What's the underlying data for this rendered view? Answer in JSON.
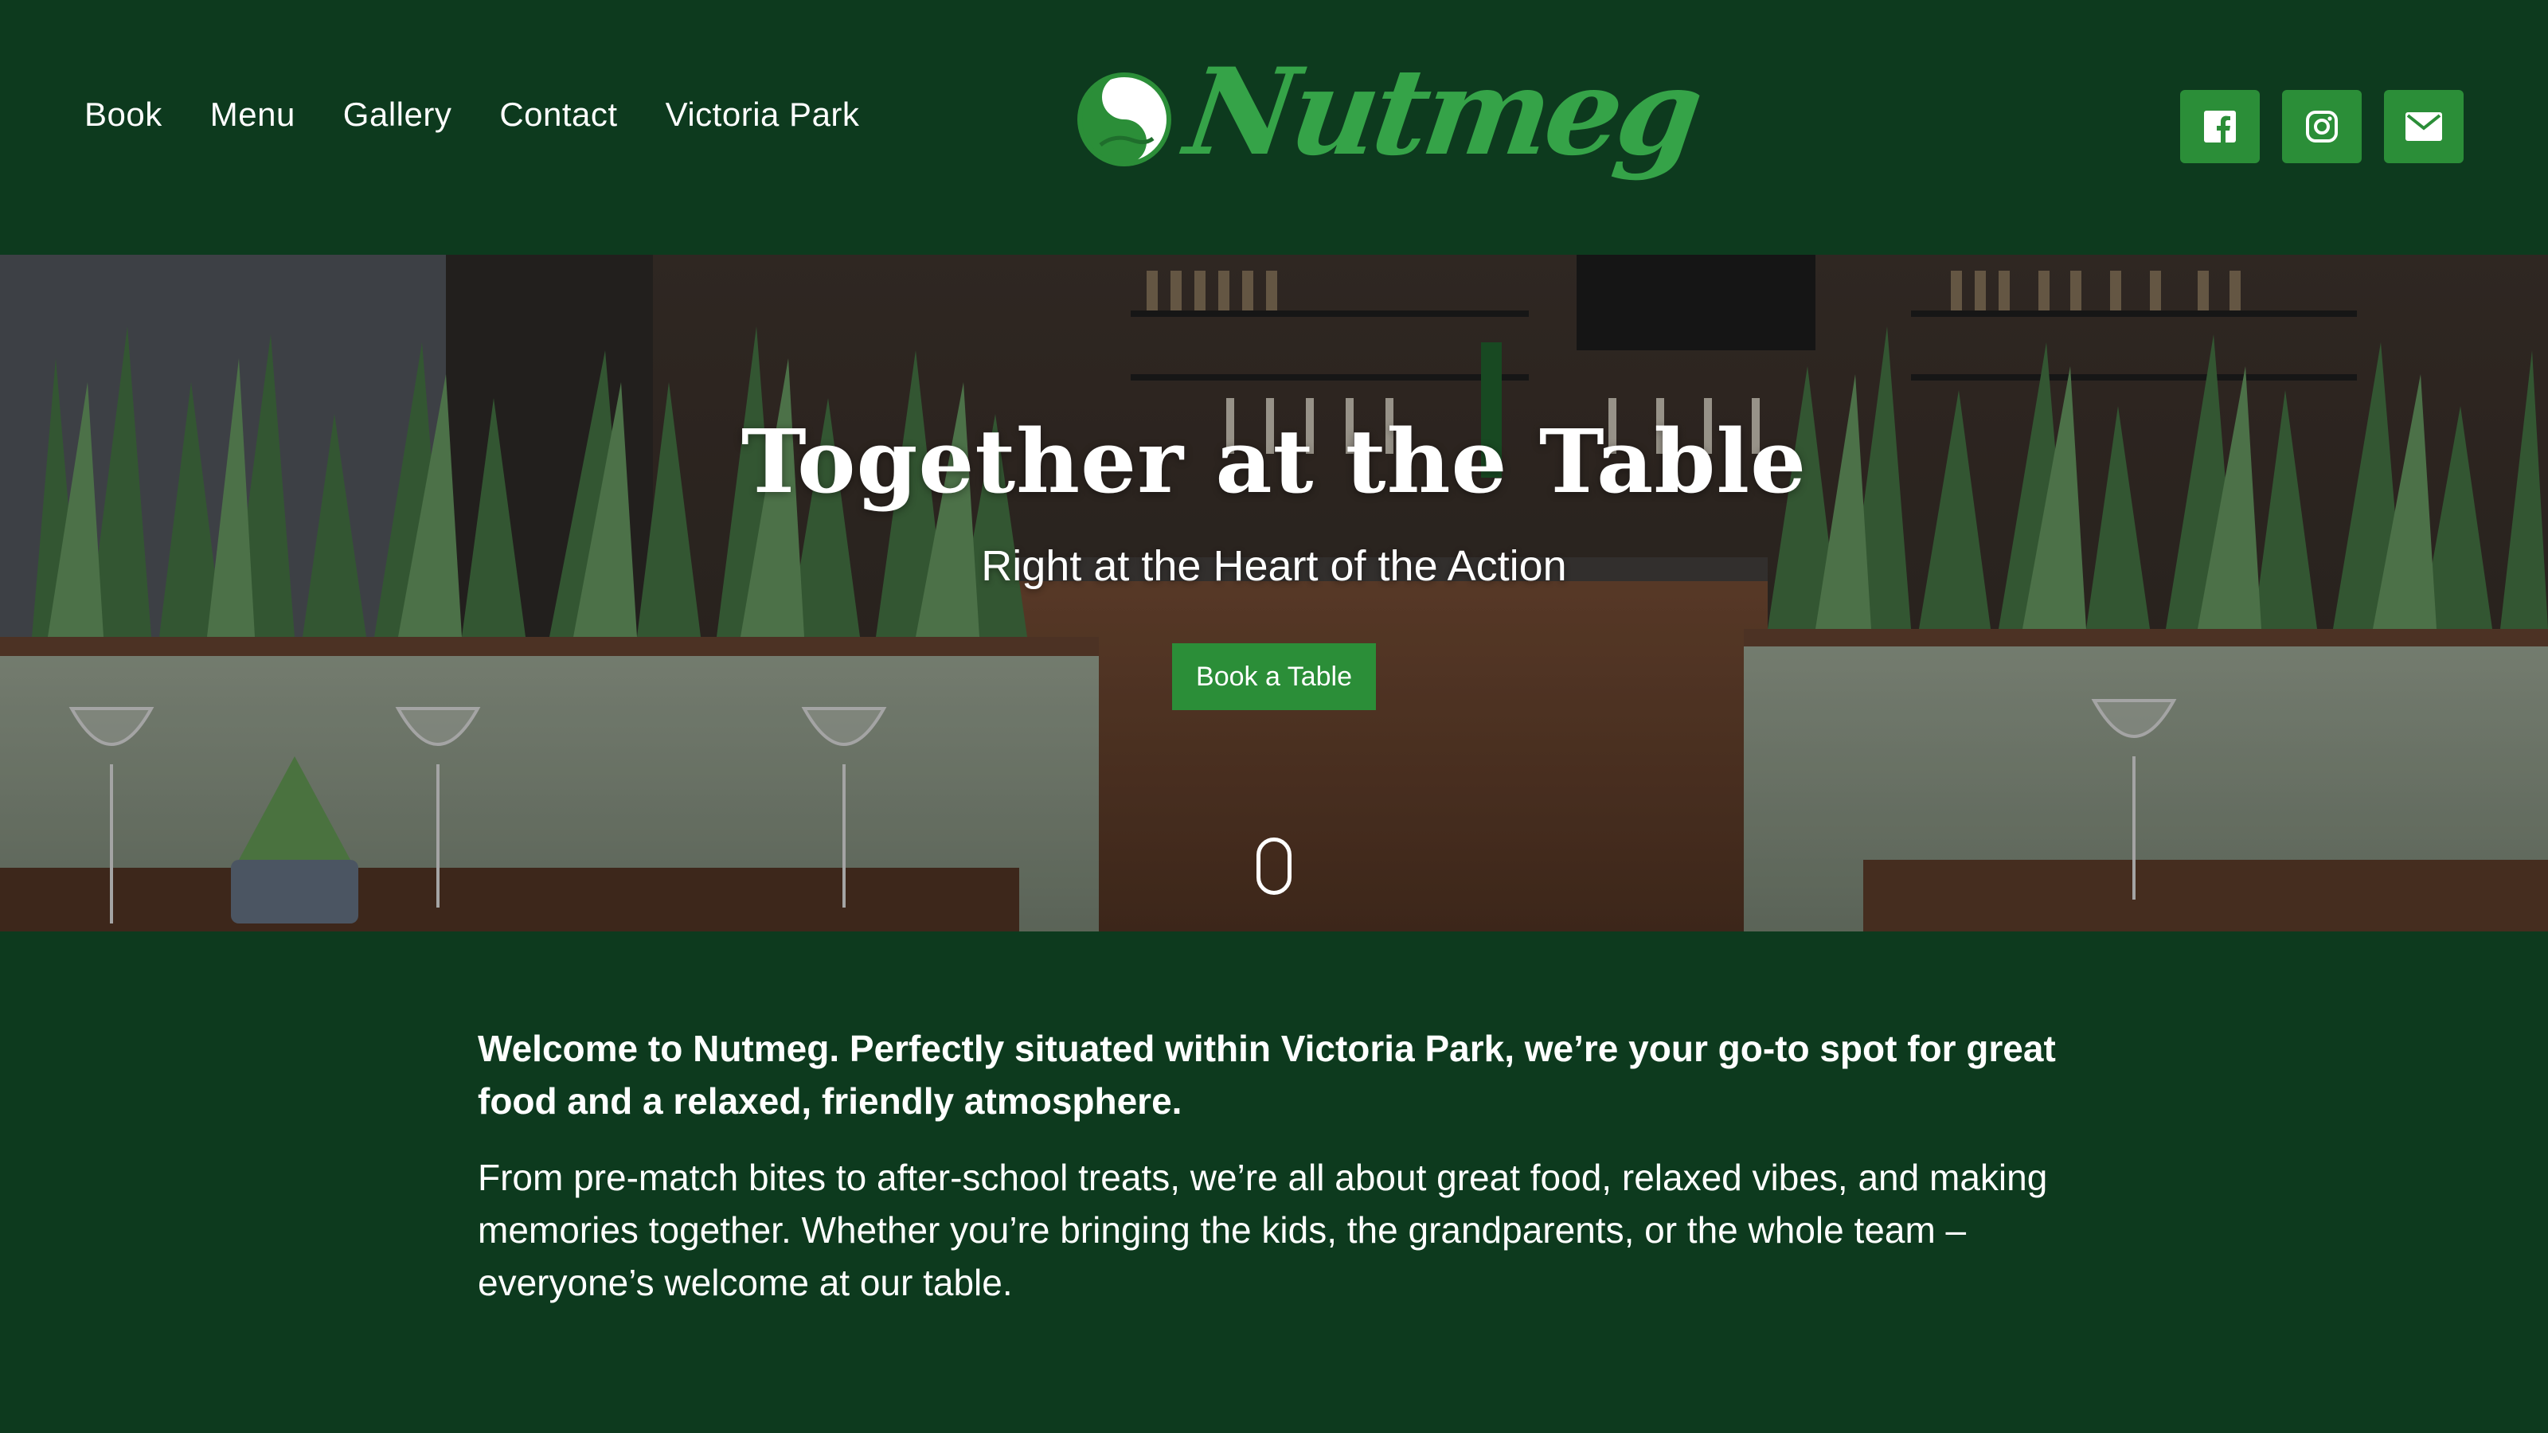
{
  "header": {
    "nav": [
      {
        "label": "Book"
      },
      {
        "label": "Menu"
      },
      {
        "label": "Gallery"
      },
      {
        "label": "Contact"
      },
      {
        "label": "Victoria Park"
      }
    ],
    "logo_text": "Nutmeg",
    "socials": [
      {
        "icon": "facebook-icon"
      },
      {
        "icon": "instagram-icon"
      },
      {
        "icon": "email-icon"
      }
    ]
  },
  "hero": {
    "title": "Together at the Table",
    "subtitle": "Right at the Heart of the Action",
    "cta_label": "Book a Table"
  },
  "intro": {
    "lead": "Welcome to Nutmeg. Perfectly situated within Victoria Park, we’re your go-to spot for great food and a relaxed, friendly atmosphere.",
    "body": "From pre-match bites to after-school treats, we’re all about great food, relaxed vibes, and making memories together. Whether you’re bringing the kids, the grandparents, or the whole team – everyone’s welcome at our table."
  },
  "colors": {
    "background": "#0d3a1e",
    "accent": "#2b8e38",
    "logo_green": "#35a348"
  }
}
